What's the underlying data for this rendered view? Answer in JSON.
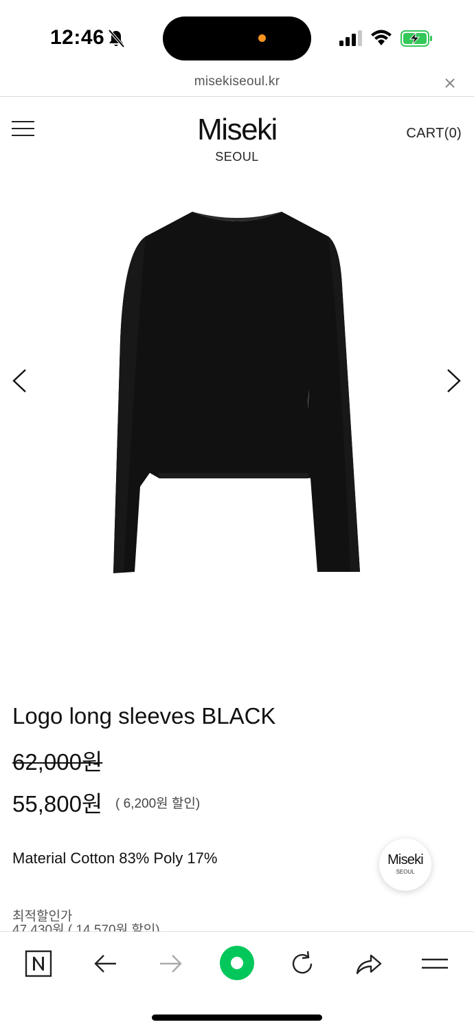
{
  "status_bar": {
    "time": "12:46",
    "icons": [
      "bell-slash-icon",
      "signal-icon",
      "wifi-icon",
      "battery-charging-icon"
    ],
    "island_dot_color": "#f7941d",
    "battery_color": "#34c759"
  },
  "browser": {
    "url": "misekiseoul.kr",
    "close_icon": "close-icon"
  },
  "header": {
    "logo_word": "Miseki",
    "logo_sub": "SEOUL",
    "cart_label": "CART(0)",
    "menu_icon": "hamburger-icon"
  },
  "product": {
    "image_icon": "long-sleeve-shirt-image",
    "title": "Logo long sleeves BLACK",
    "original_price": "62,000원",
    "sale_price": "55,800원",
    "discount_note": "( 6,200원 할인)",
    "material": "Material Cotton 83% Poly 17%",
    "best_price_label": "최적할인가",
    "best_price_value": "47,430원 ( 14,570원 할인)"
  },
  "float_badge": {
    "word": "Miseki",
    "sub": "SEOUL"
  },
  "toolbar": {
    "items": [
      "naver-n-icon",
      "back-arrow-icon",
      "forward-arrow-icon",
      "green-circle-icon",
      "reload-icon",
      "share-icon",
      "menu-icon"
    ],
    "accent": "#03c75a"
  }
}
